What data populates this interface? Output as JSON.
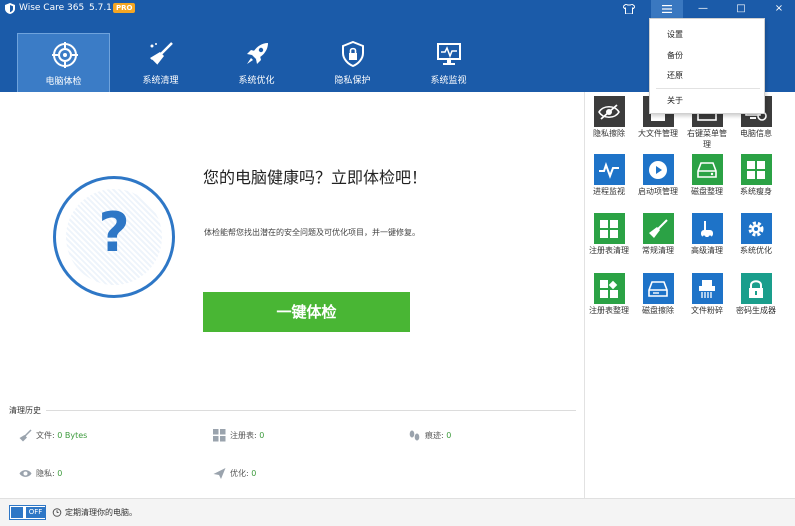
{
  "titlebar": {
    "app_name": "Wise Care 365",
    "version": "5.7.1",
    "badge": "PRO",
    "skin_icon": "shirt-icon",
    "menu_icon": "menu-icon",
    "min_glyph": "—",
    "max_glyph": "□",
    "close_glyph": "×"
  },
  "nav": {
    "tabs": [
      {
        "label": "电脑体检",
        "icon": "target-icon",
        "active": true
      },
      {
        "label": "系统清理",
        "icon": "broom-icon",
        "active": false
      },
      {
        "label": "系统优化",
        "icon": "rocket-icon",
        "active": false
      },
      {
        "label": "隐私保护",
        "icon": "shield-lock-icon",
        "active": false
      },
      {
        "label": "系统监视",
        "icon": "monitor-icon",
        "active": false
      }
    ]
  },
  "main": {
    "question_mark": "?",
    "headline": "您的电脑健康吗？立即体检吧！",
    "subline": "体检能帮您找出潜在的安全问题及可优化项目，并一键修复。",
    "scan_button": "一键体检"
  },
  "history": {
    "title": "清理历史",
    "items": [
      {
        "label": "文件:",
        "value": "0 Bytes",
        "icon": "broom-icon"
      },
      {
        "label": "注册表:",
        "value": "0",
        "icon": "blocks-icon"
      },
      {
        "label": "痕迹:",
        "value": "0",
        "icon": "footprint-icon"
      },
      {
        "label": "隐私:",
        "value": "0",
        "icon": "eye-icon"
      },
      {
        "label": "优化:",
        "value": "0",
        "icon": "plane-icon"
      }
    ]
  },
  "tools": [
    {
      "label": "隐私擦除",
      "color": "#3c3c3c",
      "icon": "eye-slash-icon"
    },
    {
      "label": "大文件管理",
      "color": "#3c3c3c",
      "icon": "file-icon"
    },
    {
      "label": "右键菜单管理",
      "color": "#3c3c3c",
      "icon": "context-menu-icon"
    },
    {
      "label": "电脑信息",
      "color": "#3c3c3c",
      "icon": "pc-info-icon"
    },
    {
      "label": "进程监视",
      "color": "#1e73c8",
      "icon": "pulse-icon"
    },
    {
      "label": "启动项管理",
      "color": "#1e73c8",
      "icon": "play-icon"
    },
    {
      "label": "磁盘整理",
      "color": "#2ba245",
      "icon": "disk-icon"
    },
    {
      "label": "系统瘦身",
      "color": "#2ba245",
      "icon": "windows-icon"
    },
    {
      "label": "注册表清理",
      "color": "#2ba245",
      "icon": "grid-icon"
    },
    {
      "label": "常规清理",
      "color": "#2ba245",
      "icon": "broom-icon"
    },
    {
      "label": "高级清理",
      "color": "#1e73c8",
      "icon": "vacuum-icon"
    },
    {
      "label": "系统优化",
      "color": "#1e73c8",
      "icon": "gear-icon"
    },
    {
      "label": "注册表整理",
      "color": "#2ba245",
      "icon": "grid-icon"
    },
    {
      "label": "磁盘擦除",
      "color": "#1e73c8",
      "icon": "disk-erase-icon"
    },
    {
      "label": "文件粉碎",
      "color": "#1e73c8",
      "icon": "shredder-icon"
    },
    {
      "label": "密码生成器",
      "color": "#1a9e8c",
      "icon": "lock-icon"
    }
  ],
  "bottom": {
    "toggle_label": "OFF",
    "schedule_text": "定期清理你的电脑。"
  },
  "menu": {
    "items": [
      "设置",
      "备份",
      "还原",
      "关于"
    ]
  },
  "colors": {
    "header": "#1b5ba9",
    "active_tab": "#3b7cc6",
    "scan_button": "#49b634",
    "accent_blue": "#2e77c6"
  }
}
